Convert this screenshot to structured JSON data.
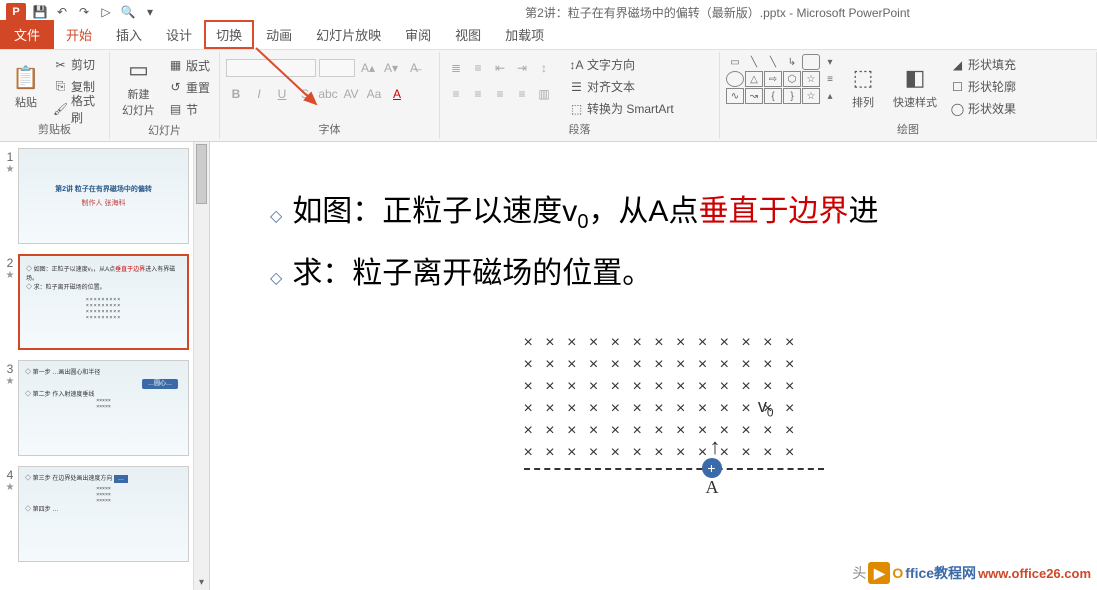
{
  "app": {
    "title": "第2讲：粒子在有界磁场中的偏转（最新版）.pptx - Microsoft PowerPoint",
    "logo": "P"
  },
  "qat": {
    "save": "💾",
    "undo": "↶",
    "redo": "↷",
    "start": "▷",
    "search": "🔍",
    "more": "▾"
  },
  "tabs": {
    "file": "文件",
    "home": "开始",
    "insert": "插入",
    "design": "设计",
    "transition": "切换",
    "animation": "动画",
    "slideshow": "幻灯片放映",
    "review": "审阅",
    "view": "视图",
    "addins": "加载项"
  },
  "ribbon": {
    "clipboard": {
      "label": "剪贴板",
      "paste": "粘贴",
      "cut": "剪切",
      "copy": "复制",
      "painter": "格式刷"
    },
    "slides": {
      "label": "幻灯片",
      "new": "新建\n幻灯片",
      "layout": "版式",
      "reset": "重置",
      "section": "节"
    },
    "font": {
      "label": "字体"
    },
    "paragraph": {
      "label": "段落",
      "textdir": "文字方向",
      "align": "对齐文本",
      "smartart": "转换为 SmartArt"
    },
    "drawing": {
      "label": "绘图",
      "arrange": "排列",
      "quickstyle": "快速样式",
      "fill": "形状填充",
      "outline": "形状轮廓",
      "effects": "形状效果"
    }
  },
  "thumbs": [
    {
      "n": "1",
      "title": "第2讲 粒子在有界磁场中的偏转",
      "sub": "制作人 张海科"
    },
    {
      "n": "2"
    },
    {
      "n": "3"
    },
    {
      "n": "4"
    }
  ],
  "slide": {
    "b1_pre": "如图：正粒子以速度v",
    "b1_sub": "0",
    "b1_mid": "，从A点",
    "b1_red": "垂直于边界",
    "b1_post": "进",
    "b2": "求：粒子离开磁场的位置。",
    "v0": "v",
    "v0sub": "0",
    "A": "A",
    "plus": "+"
  },
  "watermark": {
    "t1": "头",
    "brand": "ffice教程网",
    "url": "www.office26.com"
  }
}
